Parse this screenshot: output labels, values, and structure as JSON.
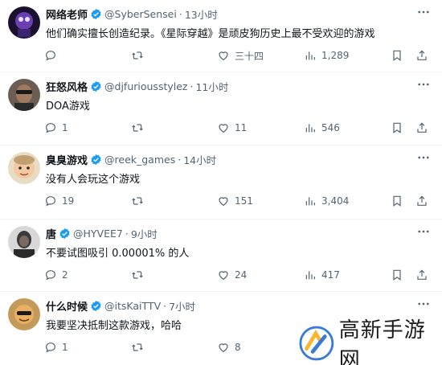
{
  "tweets": [
    {
      "name": "网络老师",
      "handle": "@SyberSensei",
      "time": "13小时",
      "text": "他们确实擅长创造纪录。《星际穿越》是顽皮狗历史上最不受欢迎的游戏",
      "replies": "",
      "retweets": "",
      "likes": "三十四",
      "views": "1,289",
      "avatar_color": "#2b1a4a"
    },
    {
      "name": "狂怒风格",
      "handle": "@djfuriousstylez",
      "time": "11小时",
      "text": "DOA游戏",
      "replies": "1",
      "retweets": "",
      "likes": "11",
      "views": "546",
      "avatar_color": "#5a4a40"
    },
    {
      "name": "臭臭游戏",
      "handle": "@reek_games",
      "time": "14小时",
      "text": "没有人会玩这个游戏",
      "replies": "19",
      "retweets": "",
      "likes": "151",
      "views": "3,404",
      "avatar_color": "#c9b48f"
    },
    {
      "name": "唐",
      "handle": "@HYVEE7",
      "time": "9小时",
      "text": "不要试图吸引 0.00001% 的人",
      "replies": "2",
      "retweets": "",
      "likes": "24",
      "views": "417",
      "avatar_color": "#3c3c3c"
    },
    {
      "name": "什么时候",
      "handle": "@itsKaiTTV",
      "time": "7小时",
      "text": "我要坚决抵制这款游戏，哈哈",
      "replies": "1",
      "retweets": "",
      "likes": "8",
      "views": "",
      "avatar_color": "#8a6a3a"
    }
  ],
  "watermark": {
    "text": "高新手游网"
  },
  "colors": {
    "verified": "#1d9bf0",
    "muted": "#536471",
    "divider": "#eff3f4"
  }
}
